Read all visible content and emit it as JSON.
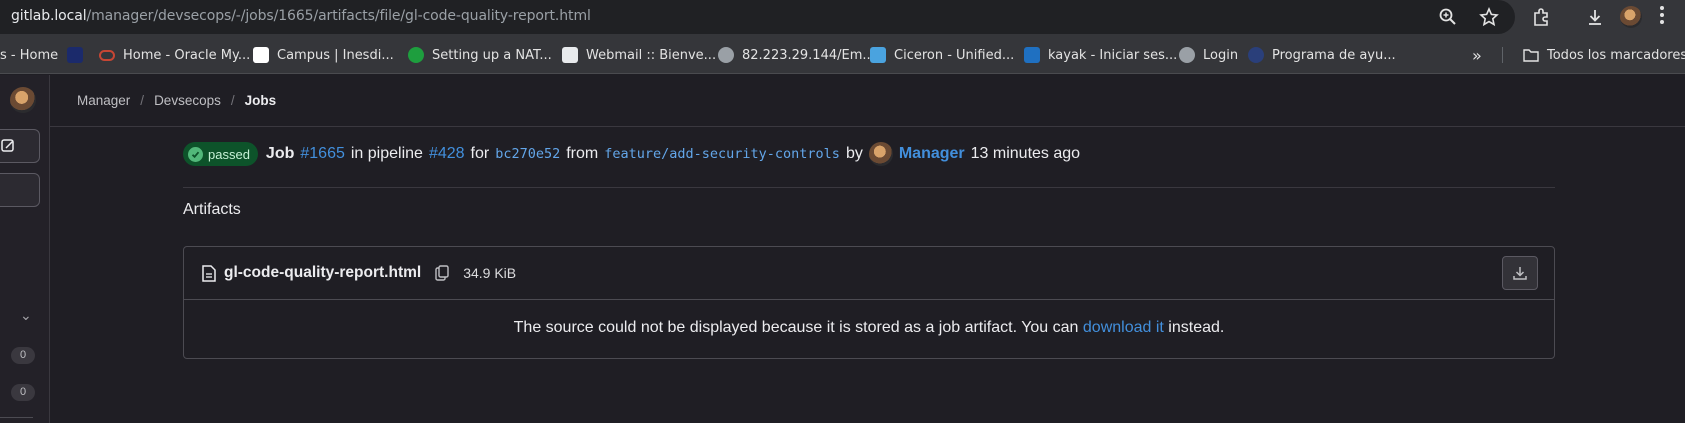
{
  "browser": {
    "url_host": "gitlab.local",
    "url_path": "/manager/devsecops/-/jobs/1665/artifacts/file/gl-code-quality-report.html",
    "bookmarks": [
      {
        "label": "s - Home",
        "color": "#35363a"
      },
      {
        "label": "",
        "color": "#1b2a6b"
      },
      {
        "label": "Home - Oracle My...",
        "color": "#c74634"
      },
      {
        "label": "Campus | Inesdi...",
        "color": "#ffffff"
      },
      {
        "label": "Setting up a NAT...",
        "color": "#1e9e3e"
      },
      {
        "label": "Webmail :: Bienve...",
        "color": "#e8eaed"
      },
      {
        "label": "82.223.29.144/Em...",
        "color": "#9aa0a6"
      },
      {
        "label": "Ciceron - Unified...",
        "color": "#4aa3df"
      },
      {
        "label": "kayak - Iniciar ses...",
        "color": "#1f70c1"
      },
      {
        "label": "Login",
        "color": "#9aa0a6"
      },
      {
        "label": "Programa de ayu...",
        "color": "#2a3f7a"
      }
    ],
    "overflow_label": "»",
    "all_bookmarks": "Todos los marcadores"
  },
  "sidebar": {
    "counts": [
      "0",
      "0"
    ]
  },
  "breadcrumb": {
    "items": [
      "Manager",
      "Devsecops"
    ],
    "active": "Jobs",
    "separator": "/"
  },
  "job": {
    "status": "passed",
    "job_word": "Job",
    "job_id": "#1665",
    "in_pipeline": "in pipeline",
    "pipeline_id": "#428",
    "for_word": "for",
    "commit_sha": "bc270e52",
    "from_word": "from",
    "branch": "feature/add-security-controls",
    "by_word": "by",
    "user": "Manager",
    "time_ago": "13 minutes ago"
  },
  "artifacts": {
    "section_title": "Artifacts",
    "file_name": "gl-code-quality-report.html",
    "file_size": "34.9 KiB",
    "message_before": "The source could not be displayed because it is stored as a job artifact. You can",
    "download_link": "download it",
    "message_after": "instead."
  },
  "colors": {
    "link": "#428fdc",
    "success_badge_bg": "#0d532a",
    "success_icon": "#52b87a"
  }
}
